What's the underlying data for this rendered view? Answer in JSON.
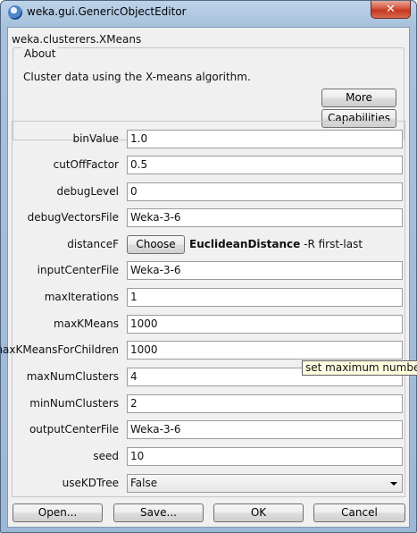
{
  "window": {
    "title": "weka.gui.GenericObjectEditor",
    "close_symbol": "✕"
  },
  "editor": {
    "class_name": "weka.clusterers.XMeans"
  },
  "about": {
    "title": "About",
    "description": "Cluster data using the X-means algorithm.",
    "more_label": "More",
    "capabilities_label": "Capabilities"
  },
  "properties": {
    "binValue": {
      "label": "binValue",
      "value": "1.0"
    },
    "cutOffFactor": {
      "label": "cutOffFactor",
      "value": "0.5"
    },
    "debugLevel": {
      "label": "debugLevel",
      "value": "0"
    },
    "debugVectorsFile": {
      "label": "debugVectorsFile",
      "value": "Weka-3-6"
    },
    "distanceF": {
      "label": "distanceF",
      "button_label": "Choose",
      "class_name": "EuclideanDistance",
      "options": "-R first-last"
    },
    "inputCenterFile": {
      "label": "inputCenterFile",
      "value": "Weka-3-6"
    },
    "maxIterations": {
      "label": "maxIterations",
      "value": "1"
    },
    "maxKMeans": {
      "label": "maxKMeans",
      "value": "1000"
    },
    "maxKMeansForChildren": {
      "label": "maxKMeansForChildren",
      "value": "1000"
    },
    "maxNumClusters": {
      "label": "maxNumClusters",
      "value": "4"
    },
    "minNumClusters": {
      "label": "minNumClusters",
      "value": "2"
    },
    "outputCenterFile": {
      "label": "outputCenterFile",
      "value": "Weka-3-6"
    },
    "seed": {
      "label": "seed",
      "value": "10"
    },
    "useKDTree": {
      "label": "useKDTree",
      "value": "False"
    }
  },
  "tooltip": {
    "text": "set maximum number"
  },
  "buttons": {
    "open": "Open...",
    "save": "Save...",
    "ok": "OK",
    "cancel": "Cancel"
  },
  "colors": {
    "title_bar": "#a8c1dc",
    "close_button": "#c5371f",
    "client_bg": "#f0f0f0",
    "tooltip_bg": "#ffffe1"
  }
}
